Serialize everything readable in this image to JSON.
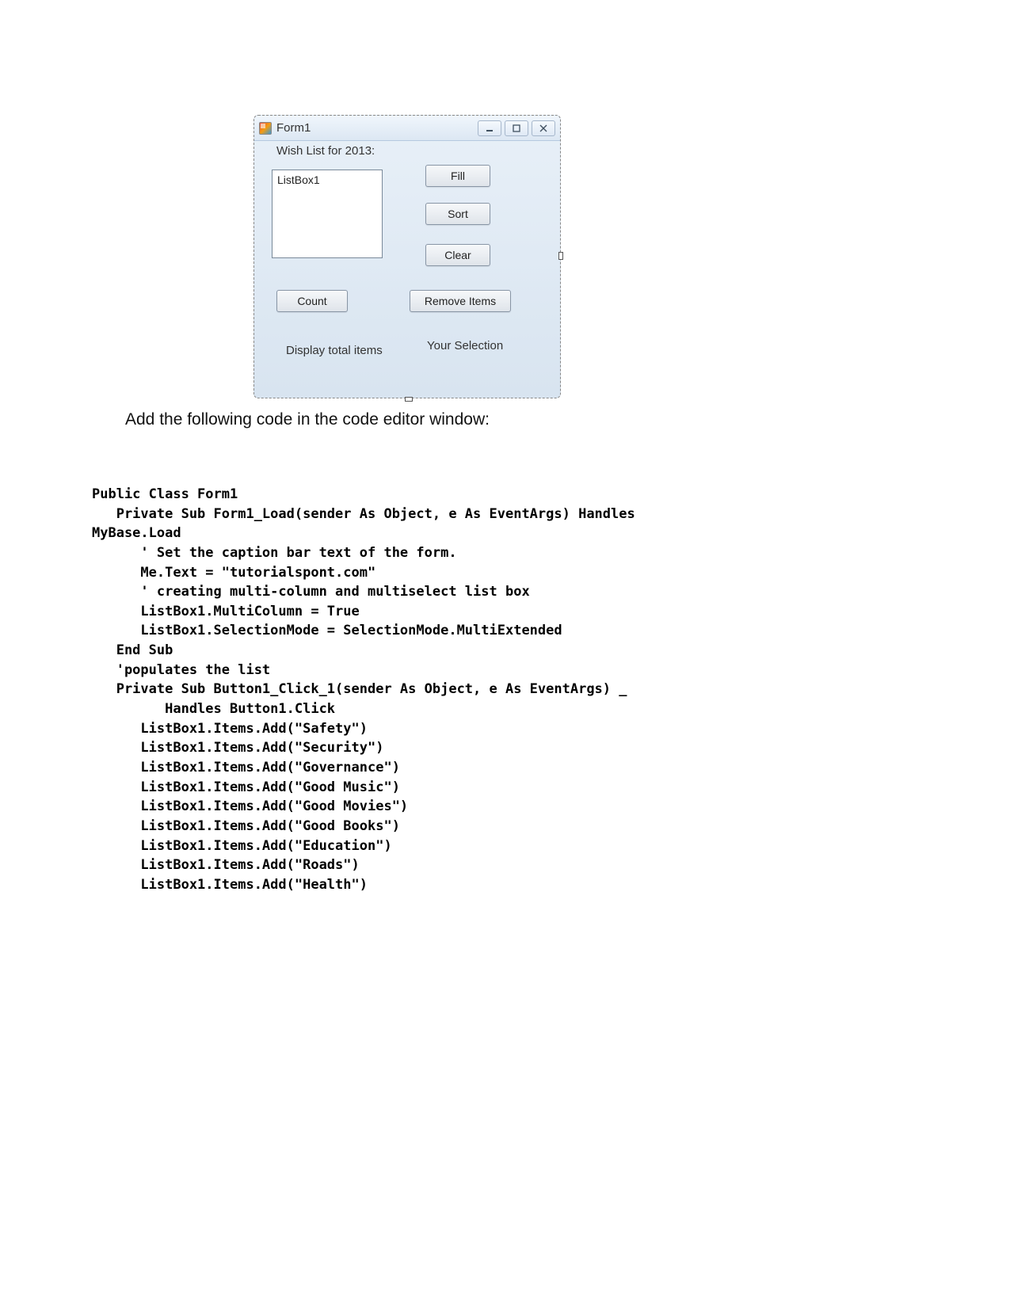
{
  "form": {
    "title": "Form1",
    "labels": {
      "wish": "Wish List for 2013:",
      "listbox_placeholder": "ListBox1",
      "display_total": "Display total items",
      "your_selection": "Your Selection"
    },
    "buttons": {
      "fill": "Fill",
      "sort": "Sort",
      "clear": "Clear",
      "count": "Count",
      "remove": "Remove Items"
    }
  },
  "instruction": "Add the following code in the code editor window:",
  "code": {
    "l1": "Public Class Form1",
    "l2": "   Private Sub Form1_Load(sender As Object, e As EventArgs) Handles",
    "l2b": "MyBase.Load",
    "l3": "      ' Set the caption bar text of the form.",
    "l4": "      Me.Text = \"tutorialspont.com\"",
    "l5": "      ' creating multi-column and multiselect list box",
    "l6": "      ListBox1.MultiColumn = True",
    "l7": "      ListBox1.SelectionMode = SelectionMode.MultiExtended",
    "l8": "   End Sub",
    "l9": "   'populates the list",
    "l10": "   Private Sub Button1_Click_1(sender As Object, e As EventArgs) _",
    "l11": "         Handles Button1.Click",
    "l12": "      ListBox1.Items.Add(\"Safety\")",
    "l13": "      ListBox1.Items.Add(\"Security\")",
    "l14": "      ListBox1.Items.Add(\"Governance\")",
    "l15": "      ListBox1.Items.Add(\"Good Music\")",
    "l16": "      ListBox1.Items.Add(\"Good Movies\")",
    "l17": "      ListBox1.Items.Add(\"Good Books\")",
    "l18": "      ListBox1.Items.Add(\"Education\")",
    "l19": "      ListBox1.Items.Add(\"Roads\")",
    "l20": "      ListBox1.Items.Add(\"Health\")"
  }
}
